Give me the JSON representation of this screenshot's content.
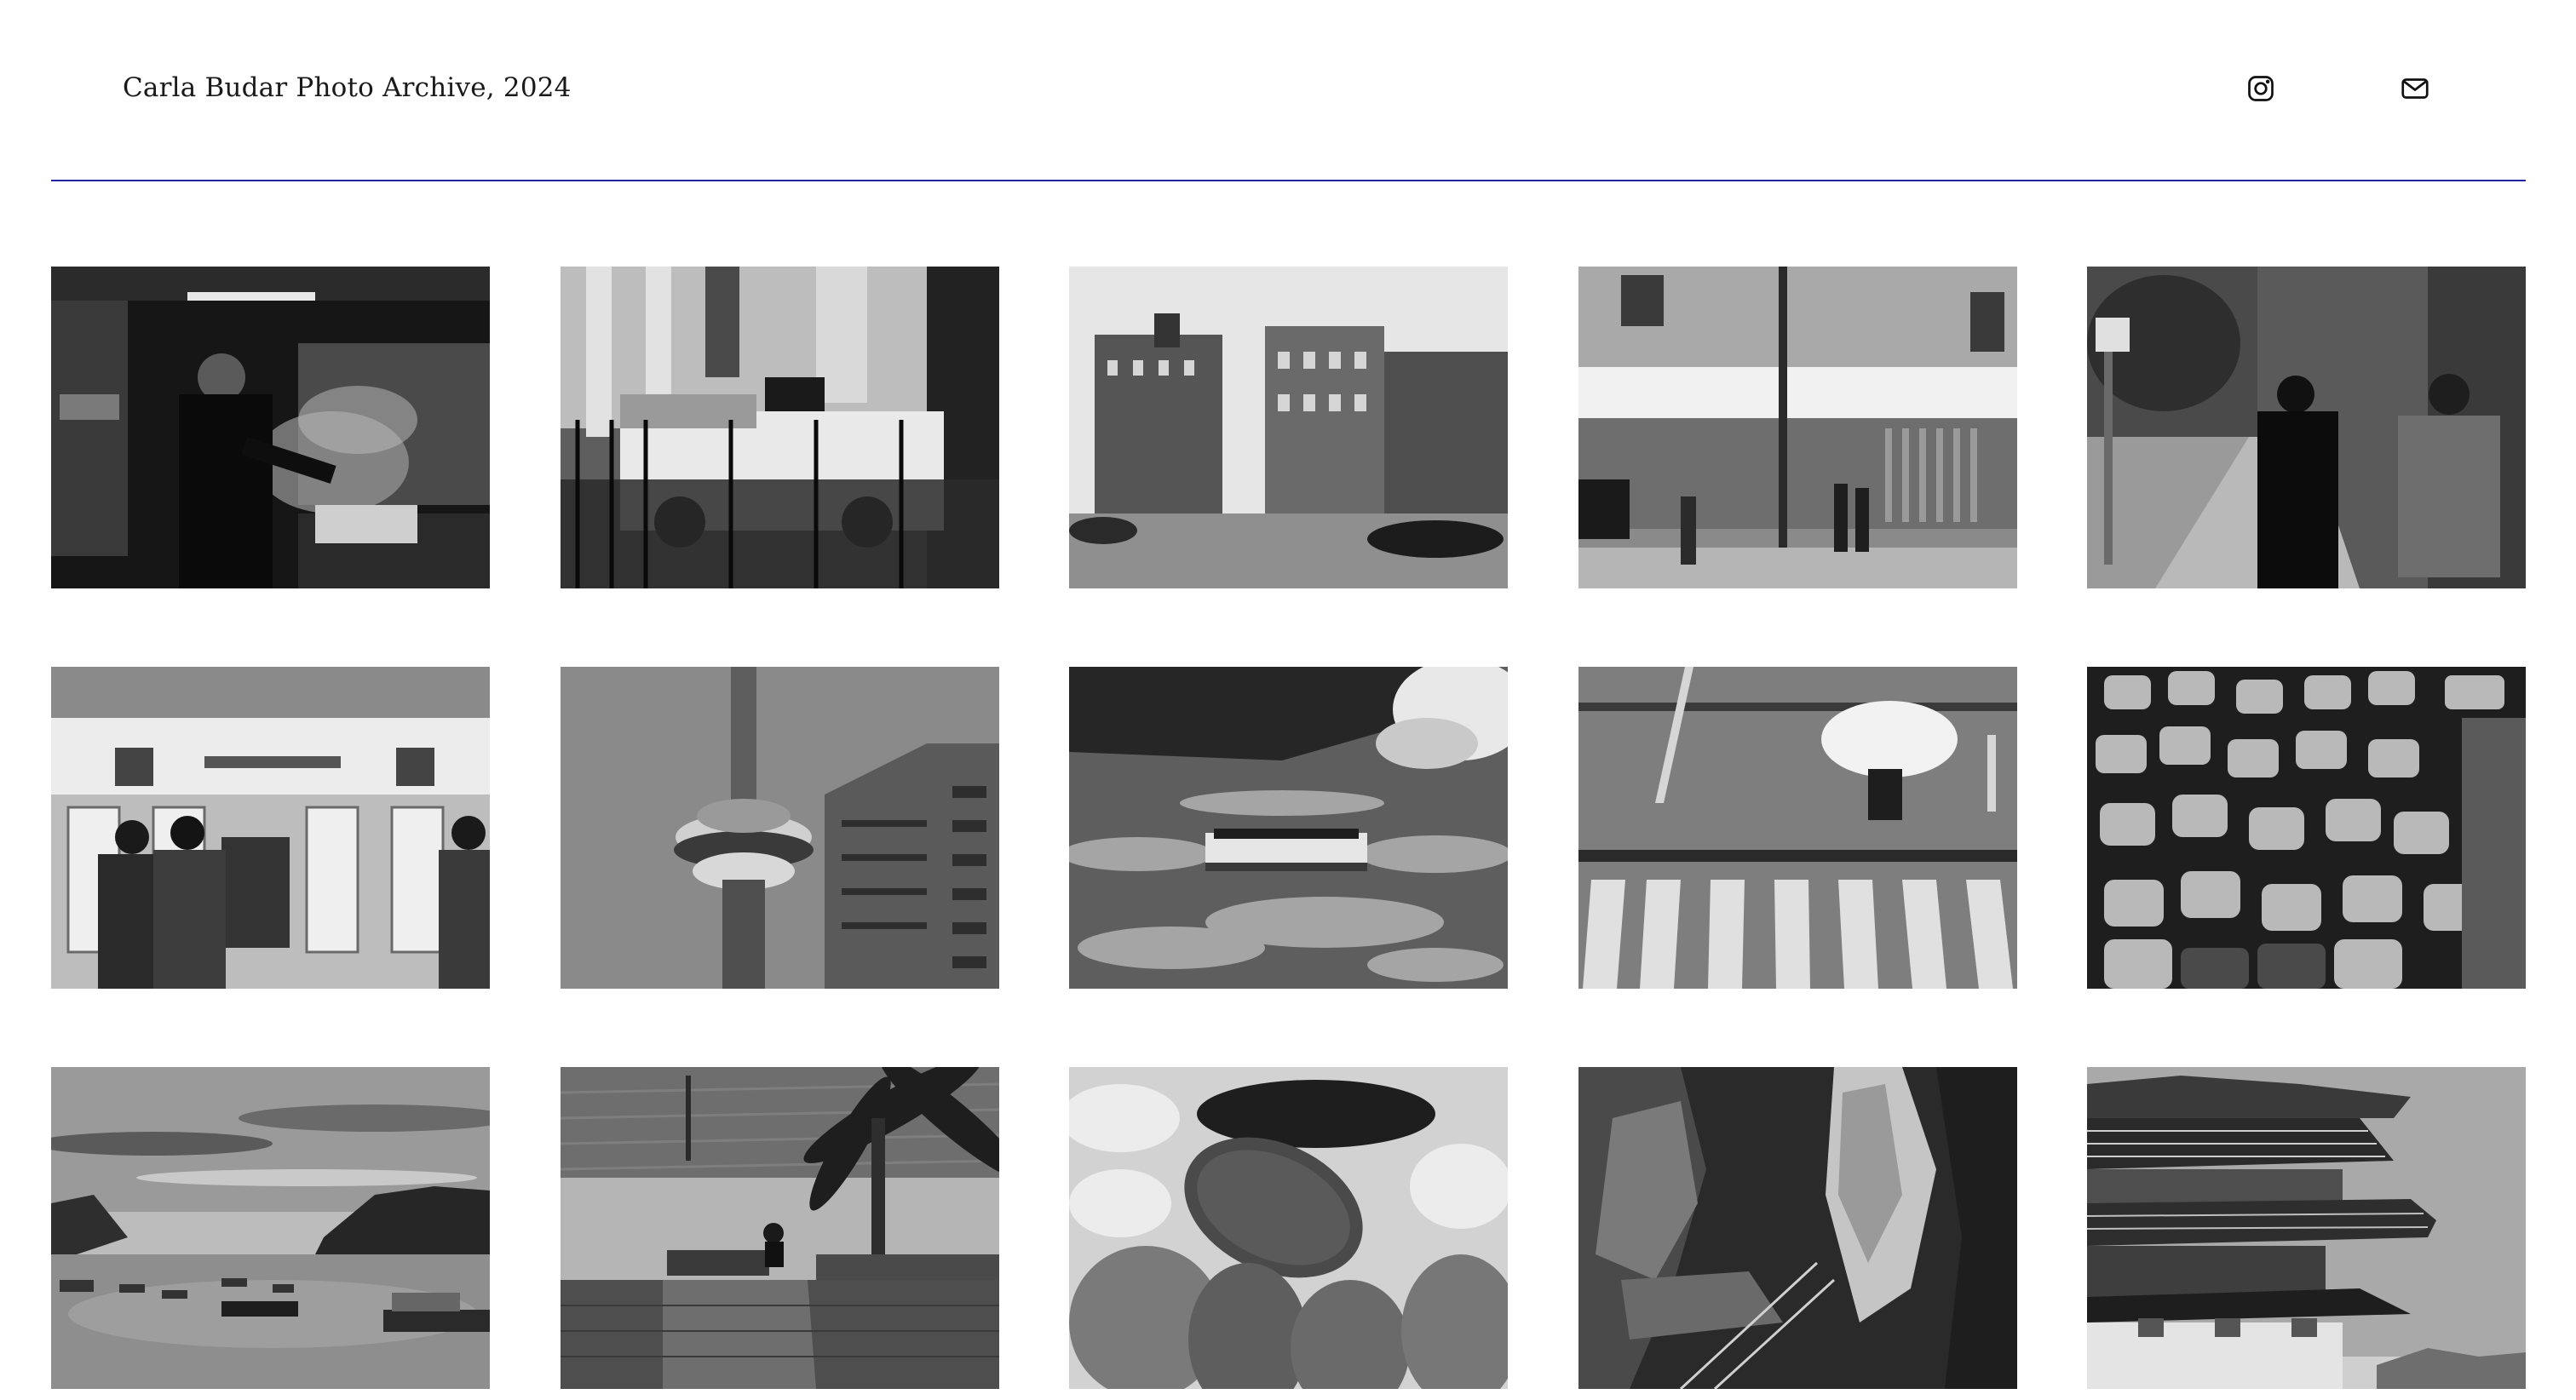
{
  "header": {
    "title": "Carla Budar Photo Archive, 2024",
    "accent_color": "#2424a8",
    "social": [
      {
        "name": "instagram",
        "icon": "instagram-icon"
      },
      {
        "name": "email",
        "icon": "mail-icon"
      }
    ]
  },
  "gallery": {
    "style": "black-and-white",
    "photos": [
      {
        "subject": "cook-at-wok-stove"
      },
      {
        "subject": "taxi-by-iron-fence"
      },
      {
        "subject": "city-street-corner-buildings"
      },
      {
        "subject": "pizza-shop-storefront"
      },
      {
        "subject": "pedestrians-on-sidewalk"
      },
      {
        "subject": "ticket-machines-station"
      },
      {
        "subject": "observation-tower-and-building"
      },
      {
        "subject": "tour-boat-in-rapids"
      },
      {
        "subject": "umbrella-at-crosswalk"
      },
      {
        "subject": "traffic-jam-aerial"
      },
      {
        "subject": "harbor-with-boats"
      },
      {
        "subject": "waterfront-palm-bench"
      },
      {
        "subject": "fish-on-ice"
      },
      {
        "subject": "rock-cliff-stairway"
      },
      {
        "subject": "temple-pagoda-roof"
      }
    ]
  }
}
